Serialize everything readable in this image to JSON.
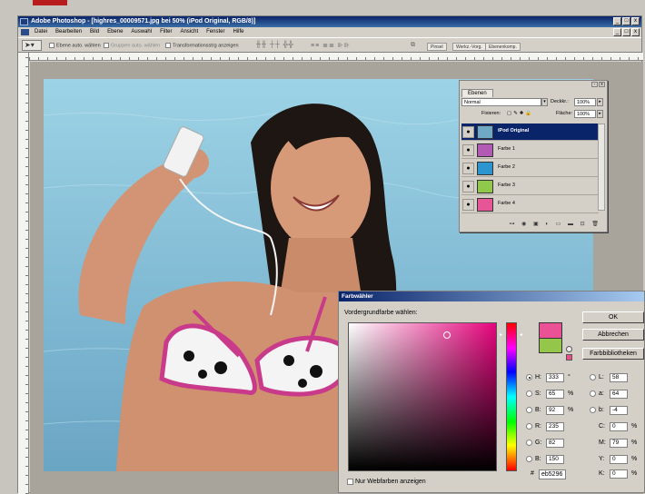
{
  "window": {
    "title": "Adobe Photoshop - [highres_00009571.jpg bei 50% (iPod Original, RGB/8)]",
    "controls": [
      "_",
      "□",
      "x"
    ]
  },
  "menu": [
    "Datei",
    "Bearbeiten",
    "Bild",
    "Ebene",
    "Auswahl",
    "Filter",
    "Ansicht",
    "Fenster",
    "Hilfe"
  ],
  "options_bar": {
    "auto_select": "Ebene auto. wählen",
    "group_select": "Gruppen auto. wählen",
    "transform": "Transformationsstrg anzeigen",
    "palette_tabs": [
      "Pinsel",
      "Werkz.-Vorg.",
      "Ebenenkomp."
    ]
  },
  "layers_panel": {
    "tab": "Ebenen",
    "blend_mode": "Normal",
    "opacity_label": "Deckkr.:",
    "opacity_value": "100%",
    "lock_label": "Fixieren:",
    "fill_label": "Fläche:",
    "fill_value": "100%",
    "layers": [
      {
        "name": "iPod Original",
        "active": true,
        "color": "#6fa9c4"
      },
      {
        "name": "Farbe 1",
        "active": false,
        "color": "#b25ab4"
      },
      {
        "name": "Farbe 2",
        "active": false,
        "color": "#2c95cf"
      },
      {
        "name": "Farbe 3",
        "active": false,
        "color": "#8fc84a"
      },
      {
        "name": "Farbe 4",
        "active": false,
        "color": "#e65596"
      }
    ]
  },
  "color_picker": {
    "title": "Farbwähler",
    "prompt": "Vordergrundfarbe wählen:",
    "buttons": {
      "ok": "OK",
      "cancel": "Abbrechen",
      "libraries": "Farbbibliotheken"
    },
    "new_color": "#eb5296",
    "old_color": "#94c64a",
    "hsb": [
      {
        "label": "H:",
        "value": "333",
        "unit": "°",
        "checked": true
      },
      {
        "label": "S:",
        "value": "65",
        "unit": "%",
        "checked": false
      },
      {
        "label": "B:",
        "value": "92",
        "unit": "%",
        "checked": false
      }
    ],
    "rgb": [
      {
        "label": "R:",
        "value": "235"
      },
      {
        "label": "G:",
        "value": "82"
      },
      {
        "label": "B:",
        "value": "150"
      }
    ],
    "lab": [
      {
        "label": "L:",
        "value": "58"
      },
      {
        "label": "a:",
        "value": "64"
      },
      {
        "label": "b:",
        "value": "-4"
      }
    ],
    "cmyk": [
      {
        "label": "C:",
        "value": "0",
        "unit": "%"
      },
      {
        "label": "M:",
        "value": "79",
        "unit": "%"
      },
      {
        "label": "Y:",
        "value": "0",
        "unit": "%"
      },
      {
        "label": "K:",
        "value": "0",
        "unit": "%"
      }
    ],
    "hex_label": "#",
    "hex": "eb5296",
    "web_only": "Nur Webfarben anzeigen"
  }
}
